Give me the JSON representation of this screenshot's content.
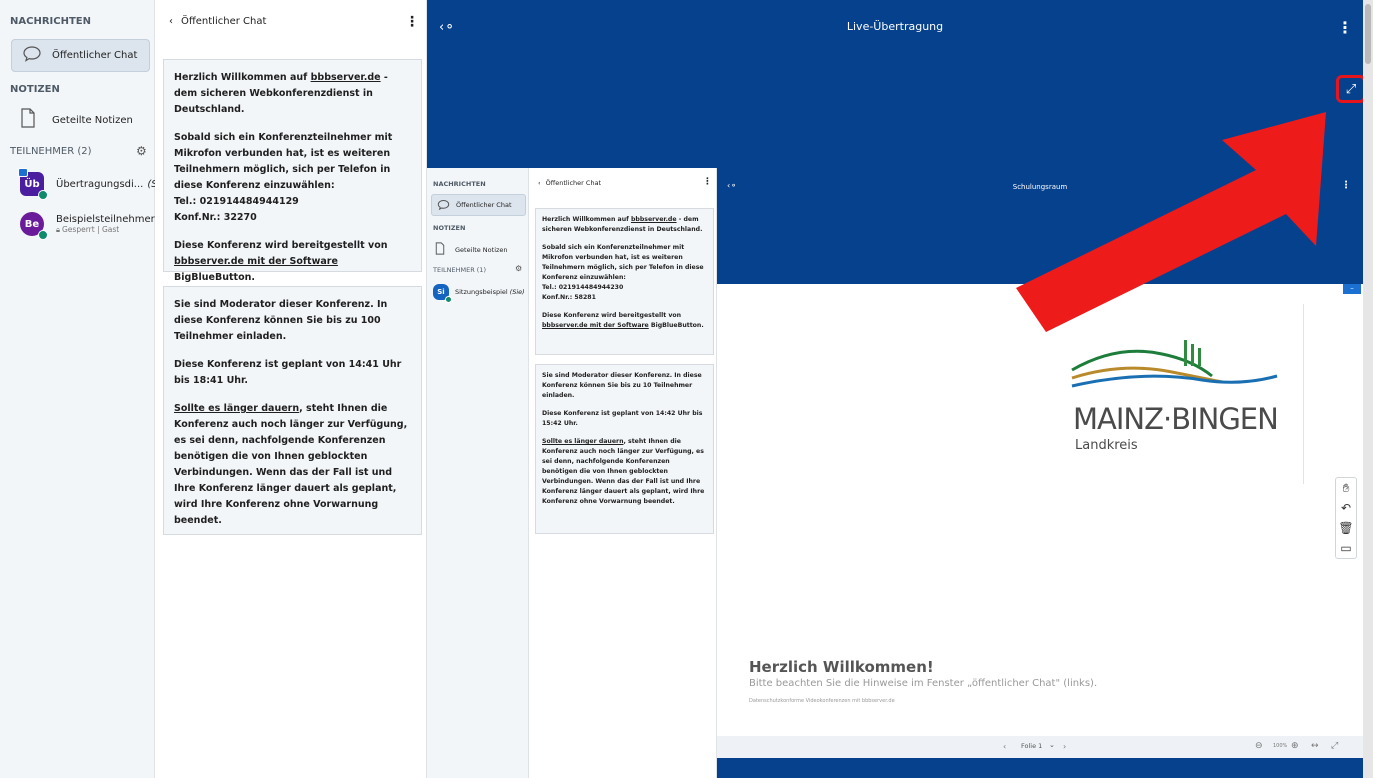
{
  "outer": {
    "userlist": {
      "messages_title": "NACHRICHTEN",
      "public_chat_label": "Öffentlicher Chat",
      "notes_title": "NOTIZEN",
      "shared_notes_label": "Geteilte Notizen",
      "participants_title": "TEILNEHMER (2)",
      "users": [
        {
          "initials": "Üb",
          "name": "Übertragungsdi...",
          "suffix": "(Sie)",
          "color": "#4a1e9e"
        },
        {
          "initials": "Be",
          "name": "Beispielsteilnehmer",
          "sub": "Gesperrt | Gast",
          "color": "#6a1b9a"
        }
      ]
    },
    "chat": {
      "back_title": "Öffentlicher Chat",
      "welcome": {
        "p1_a": "Herzlich Willkommen auf ",
        "p1_link": "bbbserver.de",
        "p1_b": " - dem sicheren Webkonferenzdienst in Deutschland.",
        "p2": "Sobald sich ein Konferenzteilnehmer mit Mikrofon verbunden hat, ist es weiteren Teilnehmern möglich, sich per Telefon in diese Konferenz einzuwählen:",
        "tel": "Tel.: 021914484944129",
        "konf": "Konf.Nr.: 32270",
        "p3_link": "bbbserver.de mit der Software",
        "p3_b": " BigBlueButton."
      },
      "p3_a": "Diese Konferenz wird bereitgestellt von",
      "moderator": {
        "p1": "Sie sind Moderator dieser Konferenz. In diese Konferenz können Sie bis zu 100 Teilnehmer einladen.",
        "p2": "Diese Konferenz ist geplant von 14:41 Uhr bis 18:41 Uhr.",
        "p3_link": "Sollte es länger dauern",
        "p3_b": ", steht Ihnen die Konferenz auch noch länger zur Verfügung, es sei denn, nachfolgende Konferenzen benötigen die von Ihnen geblockten Verbindungen. Wenn das der Fall ist und Ihre Konferenz länger dauert als geplant, wird Ihre Konferenz ohne Vorwarnung beendet."
      }
    },
    "main_title": "Live-Übertragung"
  },
  "inner": {
    "userlist": {
      "messages_title": "NACHRICHTEN",
      "public_chat_label": "Öffentlicher Chat",
      "notes_title": "NOTIZEN",
      "shared_notes_label": "Geteilte Notizen",
      "participants_title": "TEILNEHMER (1)",
      "user": {
        "initials": "Si",
        "name": "Sitzungsbeispiel",
        "suffix": "(Sie)"
      }
    },
    "chat": {
      "back_title": "Öffentlicher Chat",
      "welcome": {
        "p1_a": "Herzlich Willkommen auf ",
        "p1_link": "bbbserver.de",
        "p1_b": " - dem sicheren Webkonferenzdienst in Deutschland.",
        "p2": "Sobald sich ein Konferenzteilnehmer mit Mikrofon verbunden hat, ist es weiteren Teilnehmern möglich, sich per Telefon in diese Konferenz einzuwählen:",
        "tel": "Tel.: 021914484944230",
        "konf": "Konf.Nr.: 58281",
        "p3_a": "Diese Konferenz wird bereitgestellt von",
        "p3_link": "bbbserver.de mit der Software",
        "p3_b": " BigBlueButton."
      },
      "moderator": {
        "p1": "Sie sind Moderator dieser Konferenz. In diese Konferenz können Sie bis zu 10 Teilnehmer einladen.",
        "p2": "Diese Konferenz ist geplant von 14:42 Uhr bis 15:42 Uhr.",
        "p3_link": "Sollte es länger dauern",
        "p3_b": ", steht Ihnen die Konferenz auch noch länger zur Verfügung, es sei denn, nachfolgende Konferenzen benötigen die von Ihnen geblockten Verbindungen. Wenn das der Fall ist und Ihre Konferenz länger dauert als geplant, wird Ihre Konferenz ohne Vorwarnung beendet."
      }
    },
    "main_title": "Schulungsraum",
    "slide": {
      "brand_main": "MAINZ·BINGEN",
      "brand_sub": "Landkreis",
      "headline": "Herzlich Willkommen!",
      "subline": "Bitte beachten Sie die Hinweise im Fenster „öffentlicher Chat\" (links).",
      "footer": "Datenschutzkonforme Videokonferenzen mit bbbserver.de"
    },
    "slide_nav": {
      "label": "Folie 1",
      "zoom": "100%"
    }
  },
  "colors": {
    "brand_blue": "#06418e",
    "arrow_red": "#ee1b1b"
  }
}
